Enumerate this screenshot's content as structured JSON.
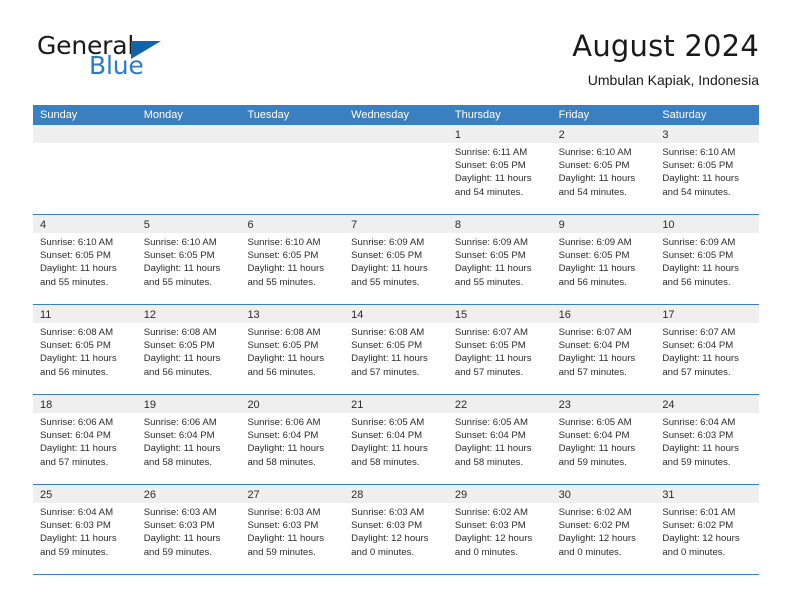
{
  "brand": {
    "name_top": "General",
    "name_bottom": "Blue",
    "flag_icon": "triangle-flag-icon",
    "accent_color": "#1263a8",
    "blue_text_color": "#2b7cc4"
  },
  "header": {
    "title": "August 2024",
    "subtitle": "Umbulan Kapiak, Indonesia"
  },
  "calendar": {
    "header_bg": "#3a7fc0",
    "day_band_bg": "#efefef",
    "weekdays": [
      "Sunday",
      "Monday",
      "Tuesday",
      "Wednesday",
      "Thursday",
      "Friday",
      "Saturday"
    ],
    "weeks": [
      [
        {
          "day": "",
          "sunrise": "",
          "sunset": "",
          "daylight_line1": "",
          "daylight_line2": ""
        },
        {
          "day": "",
          "sunrise": "",
          "sunset": "",
          "daylight_line1": "",
          "daylight_line2": ""
        },
        {
          "day": "",
          "sunrise": "",
          "sunset": "",
          "daylight_line1": "",
          "daylight_line2": ""
        },
        {
          "day": "",
          "sunrise": "",
          "sunset": "",
          "daylight_line1": "",
          "daylight_line2": ""
        },
        {
          "day": "1",
          "sunrise": "Sunrise: 6:11 AM",
          "sunset": "Sunset: 6:05 PM",
          "daylight_line1": "Daylight: 11 hours",
          "daylight_line2": "and 54 minutes."
        },
        {
          "day": "2",
          "sunrise": "Sunrise: 6:10 AM",
          "sunset": "Sunset: 6:05 PM",
          "daylight_line1": "Daylight: 11 hours",
          "daylight_line2": "and 54 minutes."
        },
        {
          "day": "3",
          "sunrise": "Sunrise: 6:10 AM",
          "sunset": "Sunset: 6:05 PM",
          "daylight_line1": "Daylight: 11 hours",
          "daylight_line2": "and 54 minutes."
        }
      ],
      [
        {
          "day": "4",
          "sunrise": "Sunrise: 6:10 AM",
          "sunset": "Sunset: 6:05 PM",
          "daylight_line1": "Daylight: 11 hours",
          "daylight_line2": "and 55 minutes."
        },
        {
          "day": "5",
          "sunrise": "Sunrise: 6:10 AM",
          "sunset": "Sunset: 6:05 PM",
          "daylight_line1": "Daylight: 11 hours",
          "daylight_line2": "and 55 minutes."
        },
        {
          "day": "6",
          "sunrise": "Sunrise: 6:10 AM",
          "sunset": "Sunset: 6:05 PM",
          "daylight_line1": "Daylight: 11 hours",
          "daylight_line2": "and 55 minutes."
        },
        {
          "day": "7",
          "sunrise": "Sunrise: 6:09 AM",
          "sunset": "Sunset: 6:05 PM",
          "daylight_line1": "Daylight: 11 hours",
          "daylight_line2": "and 55 minutes."
        },
        {
          "day": "8",
          "sunrise": "Sunrise: 6:09 AM",
          "sunset": "Sunset: 6:05 PM",
          "daylight_line1": "Daylight: 11 hours",
          "daylight_line2": "and 55 minutes."
        },
        {
          "day": "9",
          "sunrise": "Sunrise: 6:09 AM",
          "sunset": "Sunset: 6:05 PM",
          "daylight_line1": "Daylight: 11 hours",
          "daylight_line2": "and 56 minutes."
        },
        {
          "day": "10",
          "sunrise": "Sunrise: 6:09 AM",
          "sunset": "Sunset: 6:05 PM",
          "daylight_line1": "Daylight: 11 hours",
          "daylight_line2": "and 56 minutes."
        }
      ],
      [
        {
          "day": "11",
          "sunrise": "Sunrise: 6:08 AM",
          "sunset": "Sunset: 6:05 PM",
          "daylight_line1": "Daylight: 11 hours",
          "daylight_line2": "and 56 minutes."
        },
        {
          "day": "12",
          "sunrise": "Sunrise: 6:08 AM",
          "sunset": "Sunset: 6:05 PM",
          "daylight_line1": "Daylight: 11 hours",
          "daylight_line2": "and 56 minutes."
        },
        {
          "day": "13",
          "sunrise": "Sunrise: 6:08 AM",
          "sunset": "Sunset: 6:05 PM",
          "daylight_line1": "Daylight: 11 hours",
          "daylight_line2": "and 56 minutes."
        },
        {
          "day": "14",
          "sunrise": "Sunrise: 6:08 AM",
          "sunset": "Sunset: 6:05 PM",
          "daylight_line1": "Daylight: 11 hours",
          "daylight_line2": "and 57 minutes."
        },
        {
          "day": "15",
          "sunrise": "Sunrise: 6:07 AM",
          "sunset": "Sunset: 6:05 PM",
          "daylight_line1": "Daylight: 11 hours",
          "daylight_line2": "and 57 minutes."
        },
        {
          "day": "16",
          "sunrise": "Sunrise: 6:07 AM",
          "sunset": "Sunset: 6:04 PM",
          "daylight_line1": "Daylight: 11 hours",
          "daylight_line2": "and 57 minutes."
        },
        {
          "day": "17",
          "sunrise": "Sunrise: 6:07 AM",
          "sunset": "Sunset: 6:04 PM",
          "daylight_line1": "Daylight: 11 hours",
          "daylight_line2": "and 57 minutes."
        }
      ],
      [
        {
          "day": "18",
          "sunrise": "Sunrise: 6:06 AM",
          "sunset": "Sunset: 6:04 PM",
          "daylight_line1": "Daylight: 11 hours",
          "daylight_line2": "and 57 minutes."
        },
        {
          "day": "19",
          "sunrise": "Sunrise: 6:06 AM",
          "sunset": "Sunset: 6:04 PM",
          "daylight_line1": "Daylight: 11 hours",
          "daylight_line2": "and 58 minutes."
        },
        {
          "day": "20",
          "sunrise": "Sunrise: 6:06 AM",
          "sunset": "Sunset: 6:04 PM",
          "daylight_line1": "Daylight: 11 hours",
          "daylight_line2": "and 58 minutes."
        },
        {
          "day": "21",
          "sunrise": "Sunrise: 6:05 AM",
          "sunset": "Sunset: 6:04 PM",
          "daylight_line1": "Daylight: 11 hours",
          "daylight_line2": "and 58 minutes."
        },
        {
          "day": "22",
          "sunrise": "Sunrise: 6:05 AM",
          "sunset": "Sunset: 6:04 PM",
          "daylight_line1": "Daylight: 11 hours",
          "daylight_line2": "and 58 minutes."
        },
        {
          "day": "23",
          "sunrise": "Sunrise: 6:05 AM",
          "sunset": "Sunset: 6:04 PM",
          "daylight_line1": "Daylight: 11 hours",
          "daylight_line2": "and 59 minutes."
        },
        {
          "day": "24",
          "sunrise": "Sunrise: 6:04 AM",
          "sunset": "Sunset: 6:03 PM",
          "daylight_line1": "Daylight: 11 hours",
          "daylight_line2": "and 59 minutes."
        }
      ],
      [
        {
          "day": "25",
          "sunrise": "Sunrise: 6:04 AM",
          "sunset": "Sunset: 6:03 PM",
          "daylight_line1": "Daylight: 11 hours",
          "daylight_line2": "and 59 minutes."
        },
        {
          "day": "26",
          "sunrise": "Sunrise: 6:03 AM",
          "sunset": "Sunset: 6:03 PM",
          "daylight_line1": "Daylight: 11 hours",
          "daylight_line2": "and 59 minutes."
        },
        {
          "day": "27",
          "sunrise": "Sunrise: 6:03 AM",
          "sunset": "Sunset: 6:03 PM",
          "daylight_line1": "Daylight: 11 hours",
          "daylight_line2": "and 59 minutes."
        },
        {
          "day": "28",
          "sunrise": "Sunrise: 6:03 AM",
          "sunset": "Sunset: 6:03 PM",
          "daylight_line1": "Daylight: 12 hours",
          "daylight_line2": "and 0 minutes."
        },
        {
          "day": "29",
          "sunrise": "Sunrise: 6:02 AM",
          "sunset": "Sunset: 6:03 PM",
          "daylight_line1": "Daylight: 12 hours",
          "daylight_line2": "and 0 minutes."
        },
        {
          "day": "30",
          "sunrise": "Sunrise: 6:02 AM",
          "sunset": "Sunset: 6:02 PM",
          "daylight_line1": "Daylight: 12 hours",
          "daylight_line2": "and 0 minutes."
        },
        {
          "day": "31",
          "sunrise": "Sunrise: 6:01 AM",
          "sunset": "Sunset: 6:02 PM",
          "daylight_line1": "Daylight: 12 hours",
          "daylight_line2": "and 0 minutes."
        }
      ]
    ]
  }
}
